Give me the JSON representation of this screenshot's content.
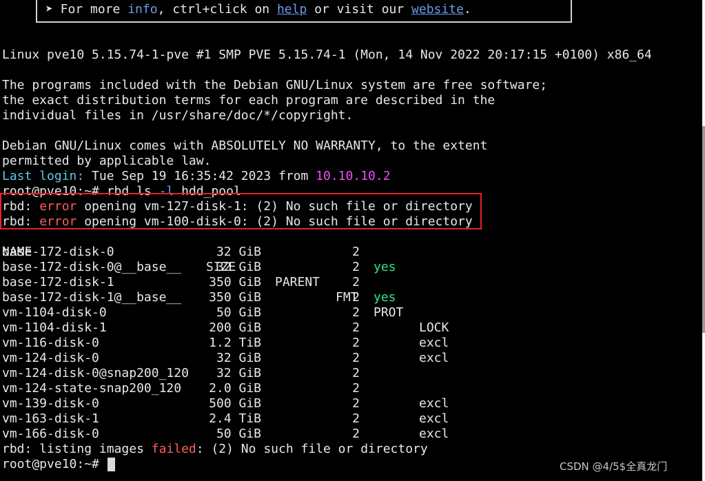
{
  "banner": {
    "prefix": "➤ For more ",
    "info": "info",
    "mid": ", ctrl+click on ",
    "help": "help",
    "mid2": " or visit our ",
    "website": "website",
    "suffix": "."
  },
  "motd": {
    "uname": "Linux pve10 5.15.74-1-pve #1 SMP PVE 5.15.74-1 (Mon, 14 Nov 2022 20:17:15 +0100) x86_64",
    "free_1": "The programs included with the Debian GNU/Linux system are free software;",
    "free_2": "the exact distribution terms for each program are described in the",
    "free_3": "individual files in /usr/share/doc/*/copyright.",
    "warranty_1": "Debian GNU/Linux comes with ABSOLUTELY NO WARRANTY, to the extent",
    "warranty_2": "permitted by applicable law.",
    "last_login_label": "Last login:",
    "last_login_time": " Tue Sep 19 16:35:42 2023 from ",
    "last_login_ip": "10.10.10.2"
  },
  "command": {
    "prompt": "root@pve10:~# ",
    "cmd_name": "rbd",
    "cmd_rest": " ls ",
    "cmd_flag": "-l",
    "cmd_pool": " hdd_pool"
  },
  "errors": [
    {
      "prefix": "rbd: ",
      "word": "error",
      "message": " opening vm-127-disk-1: (2) No such file or directory"
    },
    {
      "prefix": "rbd: ",
      "word": "error",
      "message": " opening vm-100-disk-0: (2) No such file or directory"
    }
  ],
  "table": {
    "headers": {
      "name": "NAME",
      "size": "SIZE",
      "parent": "PARENT",
      "fmt": "FMT",
      "prot": "PROT",
      "lock": "LOCK"
    },
    "rows": [
      {
        "name": "base-172-disk-0",
        "size": "32 GiB",
        "fmt": "2",
        "prot": "",
        "lock": ""
      },
      {
        "name": "base-172-disk-0@__base__",
        "size": "32 GiB",
        "fmt": "2",
        "prot": "yes",
        "lock": ""
      },
      {
        "name": "base-172-disk-1",
        "size": "350 GiB",
        "fmt": "2",
        "prot": "",
        "lock": ""
      },
      {
        "name": "base-172-disk-1@__base__",
        "size": "350 GiB",
        "fmt": "2",
        "prot": "yes",
        "lock": ""
      },
      {
        "name": "vm-1104-disk-0",
        "size": "50 GiB",
        "fmt": "2",
        "prot": "",
        "lock": ""
      },
      {
        "name": "vm-1104-disk-1",
        "size": "200 GiB",
        "fmt": "2",
        "prot": "",
        "lock": ""
      },
      {
        "name": "vm-116-disk-0",
        "size": "1.2 TiB",
        "fmt": "2",
        "prot": "",
        "lock": "excl"
      },
      {
        "name": "vm-124-disk-0",
        "size": "32 GiB",
        "fmt": "2",
        "prot": "",
        "lock": "excl"
      },
      {
        "name": "vm-124-disk-0@snap200_120",
        "size": "32 GiB",
        "fmt": "2",
        "prot": "",
        "lock": ""
      },
      {
        "name": "vm-124-state-snap200_120",
        "size": "2.0 GiB",
        "fmt": "2",
        "prot": "",
        "lock": ""
      },
      {
        "name": "vm-139-disk-0",
        "size": "500 GiB",
        "fmt": "2",
        "prot": "",
        "lock": "excl"
      },
      {
        "name": "vm-163-disk-1",
        "size": "2.4 TiB",
        "fmt": "2",
        "prot": "",
        "lock": "excl"
      },
      {
        "name": "vm-166-disk-0",
        "size": "50 GiB",
        "fmt": "2",
        "prot": "",
        "lock": "excl"
      }
    ]
  },
  "listing_error": {
    "prefix": "rbd: listing images ",
    "word": "failed",
    "message": ": (2) No such file or directory"
  },
  "final_prompt": "root@pve10:~# ",
  "watermark": "CSDN @4/5$全真龙门",
  "colors": {
    "background": "#000000",
    "text": "#e8e8e8",
    "error": "#ff5c5c",
    "yes": "#2ee88a",
    "highlight_box": "#e8212b",
    "last_login_label": "#5fc7e6",
    "ip": "#f04df0"
  }
}
